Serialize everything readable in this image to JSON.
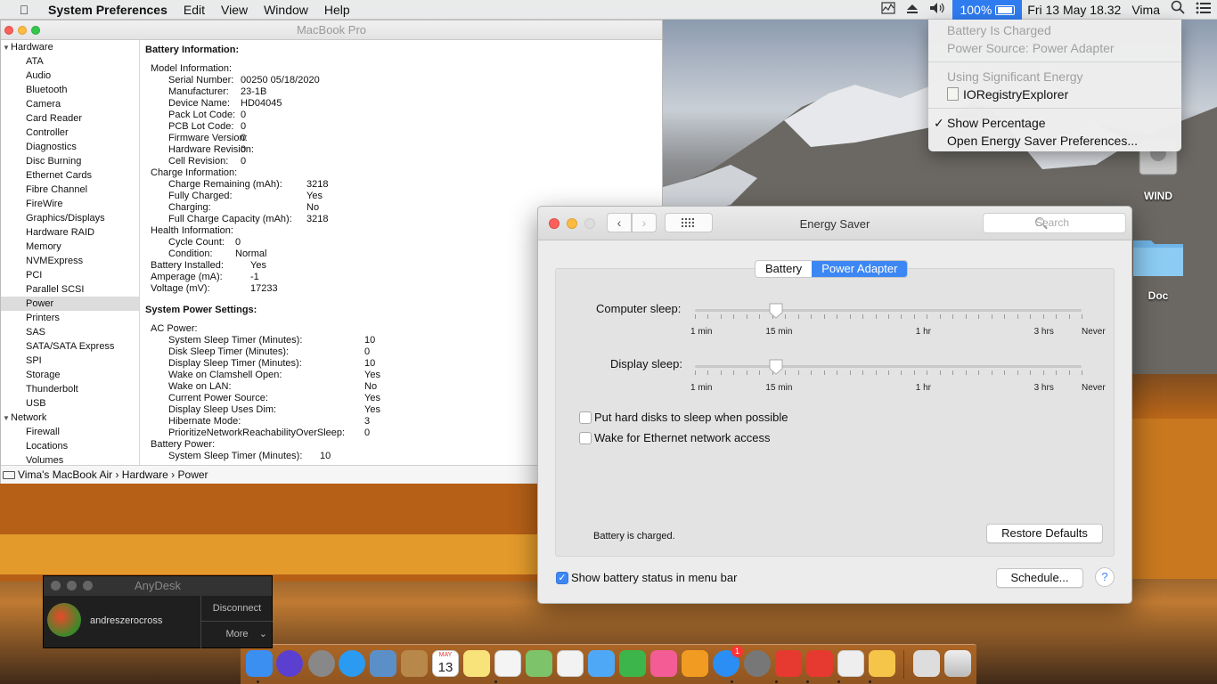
{
  "menubar": {
    "app_name": "System Preferences",
    "menus": [
      "Edit",
      "View",
      "Window",
      "Help"
    ],
    "battery_percent": "100%",
    "datetime": "Fri 13 May  18.32",
    "user": "Vima"
  },
  "battery_menu": {
    "status": "Battery Is Charged",
    "power_source": "Power Source: Power Adapter",
    "using_energy_header": "Using Significant Energy",
    "app": "IORegistryExplorer",
    "show_percentage": "Show Percentage",
    "open_prefs": "Open Energy Saver Preferences..."
  },
  "sysinfo": {
    "window_title": "MacBook Pro",
    "sidebar": {
      "group_hardware": "Hardware",
      "hardware_items": [
        "ATA",
        "Audio",
        "Bluetooth",
        "Camera",
        "Card Reader",
        "Controller",
        "Diagnostics",
        "Disc Burning",
        "Ethernet Cards",
        "Fibre Channel",
        "FireWire",
        "Graphics/Displays",
        "Hardware RAID",
        "Memory",
        "NVMExpress",
        "PCI",
        "Parallel SCSI",
        "Power",
        "Printers",
        "SAS",
        "SATA/SATA Express",
        "SPI",
        "Storage",
        "Thunderbolt",
        "USB"
      ],
      "group_network": "Network",
      "network_items": [
        "Firewall",
        "Locations",
        "Volumes"
      ]
    },
    "battery_header": "Battery Information:",
    "model_info_label": "Model Information:",
    "model_info": [
      {
        "k": "Serial Number:",
        "v": "00250 05/18/2020"
      },
      {
        "k": "Manufacturer:",
        "v": "23-1B"
      },
      {
        "k": "Device Name:",
        "v": "HD04045"
      },
      {
        "k": "Pack Lot Code:",
        "v": "0"
      },
      {
        "k": "PCB Lot Code:",
        "v": "0"
      },
      {
        "k": "Firmware Version:",
        "v": "0"
      },
      {
        "k": "Hardware Revision:",
        "v": "0"
      },
      {
        "k": "Cell Revision:",
        "v": "0"
      }
    ],
    "charge_info_label": "Charge Information:",
    "charge_info": [
      {
        "k": "Charge Remaining (mAh):",
        "v": "3218"
      },
      {
        "k": "Fully Charged:",
        "v": "Yes"
      },
      {
        "k": "Charging:",
        "v": "No"
      },
      {
        "k": "Full Charge Capacity (mAh):",
        "v": "3218"
      }
    ],
    "health_info_label": "Health Information:",
    "health_info": [
      {
        "k": "Cycle Count:",
        "v": "0"
      },
      {
        "k": "Condition:",
        "v": "Normal"
      }
    ],
    "battery_misc": [
      {
        "k": "Battery Installed:",
        "v": "Yes"
      },
      {
        "k": "Amperage (mA):",
        "v": "-1"
      },
      {
        "k": "Voltage (mV):",
        "v": "17233"
      }
    ],
    "power_header": "System Power Settings:",
    "ac_power_label": "AC Power:",
    "ac_power": [
      {
        "k": "System Sleep Timer (Minutes):",
        "v": "10"
      },
      {
        "k": "Disk Sleep Timer (Minutes):",
        "v": "0"
      },
      {
        "k": "Display Sleep Timer (Minutes):",
        "v": "10"
      },
      {
        "k": "Wake on Clamshell Open:",
        "v": "Yes"
      },
      {
        "k": "Wake on LAN:",
        "v": "No"
      },
      {
        "k": "Current Power Source:",
        "v": "Yes"
      },
      {
        "k": "Display Sleep Uses Dim:",
        "v": "Yes"
      },
      {
        "k": "Hibernate Mode:",
        "v": "3"
      },
      {
        "k": "PrioritizeNetworkReachabilityOverSleep:",
        "v": "0"
      }
    ],
    "battery_power_label": "Battery Power:",
    "battery_power_partial": "System Sleep Timer (Minutes):",
    "battery_power_partial_value": "10",
    "path": [
      "Vima's MacBook Air",
      "Hardware",
      "Power"
    ]
  },
  "energy_saver": {
    "title": "Energy Saver",
    "search_placeholder": "Search",
    "tabs": [
      "Battery",
      "Power Adapter"
    ],
    "active_tab": "Power Adapter",
    "computer_sleep_label": "Computer sleep:",
    "display_sleep_label": "Display sleep:",
    "slider_ticks": [
      "1 min",
      "15 min",
      "1 hr",
      "3 hrs",
      "Never"
    ],
    "computer_sleep_value": "10 min",
    "display_sleep_value": "10 min",
    "checkbox_hard_disks": "Put hard disks to sleep when possible",
    "checkbox_hard_disks_checked": false,
    "checkbox_wake_ethernet": "Wake for Ethernet network access",
    "checkbox_wake_ethernet_checked": false,
    "status_text": "Battery is charged.",
    "restore_defaults": "Restore Defaults",
    "show_battery_status": "Show battery status in menu bar",
    "show_battery_status_checked": true,
    "schedule": "Schedule...",
    "help": "?"
  },
  "desktop": {
    "icon1": "WIND",
    "icon2": "Doc"
  },
  "anydesk": {
    "title": "AnyDesk",
    "user": "andreszerocross",
    "disconnect": "Disconnect",
    "more": "More"
  },
  "dock": {
    "calendar_month": "MAY",
    "calendar_day": "13",
    "appstore_badge": "1"
  }
}
